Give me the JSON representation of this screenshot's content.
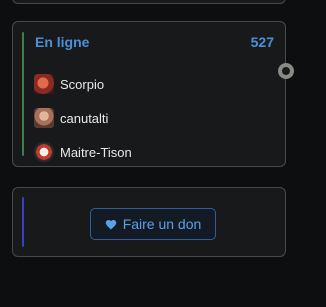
{
  "online": {
    "title": "En ligne",
    "count": "527",
    "users": [
      {
        "name": "Scorpio"
      },
      {
        "name": "canutalti"
      },
      {
        "name": "Maitre-Tison"
      }
    ]
  },
  "donate": {
    "label": "Faire un don",
    "icon": "heart-icon"
  },
  "colors": {
    "accent": "#4a90d9",
    "green_bar": "#3f7d4a",
    "blue_bar": "#3c3fbf"
  }
}
